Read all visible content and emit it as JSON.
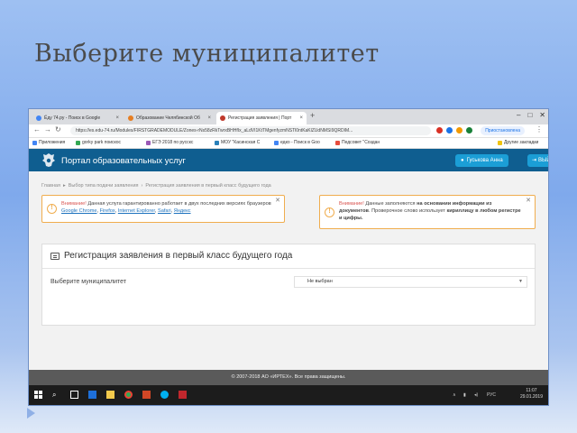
{
  "slide": {
    "title": "Выберите муниципалитет"
  },
  "browser": {
    "tabs": [
      {
        "label": "Ёду 74.ру - Поиск в Google",
        "active": false,
        "favicon_color": "#4285f4"
      },
      {
        "label": "Образование Челябинской Об",
        "active": false,
        "favicon_color": "#e67e22"
      },
      {
        "label": "Регистрация заявления | Порт",
        "active": true,
        "favicon_color": "#c0392b"
      }
    ],
    "new_tab": "+",
    "window_controls": [
      "–",
      "□",
      "✕"
    ],
    "url": "https://es.edu-74.ru/Modules/FIRSTGRADEMODULE/Zones-rNs58zRkTwrxBHHfIx_aLdVI1KtTMgenfyzmNSTl0ntKaKlZUdNMSI9QRDIM...",
    "profile_label": "Приостановлена",
    "bookmarks": [
      {
        "label": "Приложения",
        "color": "#4285f4"
      },
      {
        "label": "gorky park поискос",
        "color": "#34a853"
      },
      {
        "label": "ЕГЭ 2018 по русскс",
        "color": "#9b59b6"
      },
      {
        "label": "МОУ \"Касинская С",
        "color": "#2980b9"
      },
      {
        "label": "едко - Поиск в Goo",
        "color": "#4285f4"
      },
      {
        "label": "Педсовет \"Создан",
        "color": "#e74c3c"
      },
      {
        "label": "Другие закладки",
        "color": "#f1c40f"
      }
    ]
  },
  "site": {
    "portal_title": "Портал образовательных услуг",
    "user_name": "Гуськова Анна",
    "logout_label": "ВЫЙТИ",
    "breadcrumb": [
      "Главная",
      "Выбор типа подачи заявления",
      "Регистрация заявления в первый класс будущего года"
    ],
    "alert_left": {
      "prefix": "Внимание!",
      "text": "Данная услуга гарантированно работает в двух последних версиях браузеров",
      "links": [
        "Google Chrome",
        "Firefox",
        "Internet Explorer",
        "Safari",
        "Яндекс"
      ]
    },
    "alert_right": {
      "prefix": "Внимание!",
      "text1": "Данные заполняются",
      "bold1": "на основании информации из документов",
      "text2": ". Проверочное слово использует",
      "bold2": "кириллицу в любом регистре и цифры."
    },
    "panel_title": "Регистрация заявления в первый класс будущего года",
    "field_label": "Выберите муниципалитет",
    "select_value": "Не выбран",
    "footer": "© 2007-2018 АО «ИРТЕХ». Все права защищены."
  },
  "taskbar": {
    "language": "РУС",
    "time": "11:07",
    "date": "29.01.2019"
  }
}
